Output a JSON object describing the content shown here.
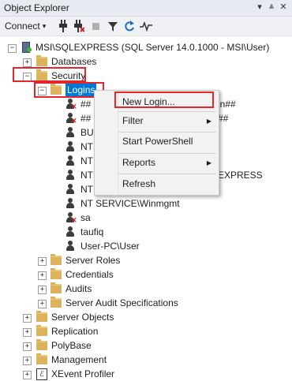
{
  "window": {
    "title": "Object Explorer",
    "pin_glyph": "⩓",
    "close_glyph": "✕",
    "menu_glyph": "▾"
  },
  "toolbar": {
    "connect_label": "Connect",
    "connect_arrow": "▾"
  },
  "tree": {
    "server_label": "MSI\\SQLEXPRESS (SQL Server 14.0.1000 - MSI\\User)",
    "databases": "Databases",
    "security": "Security",
    "logins": "Logins",
    "login_items": [
      {
        "label": "##",
        "tail": "in##",
        "icon": "user-disabled"
      },
      {
        "label": "##",
        "tail": "##",
        "icon": "user-disabled"
      },
      {
        "label": "BU",
        "tail": "",
        "icon": "user"
      },
      {
        "label": "NT",
        "tail": "",
        "icon": "user"
      },
      {
        "label": "NT",
        "tail": "",
        "icon": "user"
      },
      {
        "label": "NT",
        "tail": "EXPRESS",
        "icon": "user"
      },
      {
        "label": "NT",
        "tail": "",
        "icon": "user"
      },
      {
        "label": "NT SERVICE\\Winmgmt",
        "tail": "",
        "icon": "user"
      },
      {
        "label": "sa",
        "tail": "",
        "icon": "user-disabled"
      },
      {
        "label": "taufiq",
        "tail": "",
        "icon": "user"
      },
      {
        "label": "User-PC\\User",
        "tail": "",
        "icon": "user"
      }
    ],
    "security_children": [
      "Server Roles",
      "Credentials",
      "Audits",
      "Server Audit Specifications"
    ],
    "top_level": [
      "Server Objects",
      "Replication",
      "PolyBase",
      "Management",
      "XEvent Profiler"
    ]
  },
  "context_menu": {
    "items": [
      {
        "label": "New Login...",
        "submenu": false
      },
      {
        "label": "Filter",
        "submenu": true
      },
      {
        "label": "Start PowerShell",
        "submenu": false
      },
      {
        "label": "Reports",
        "submenu": true
      },
      {
        "label": "Refresh",
        "submenu": false
      }
    ],
    "submenu_glyph": "▶"
  },
  "colors": {
    "highlight_box": "#e2262b",
    "selection": "#0078d7",
    "folder": "#dcb35c"
  }
}
